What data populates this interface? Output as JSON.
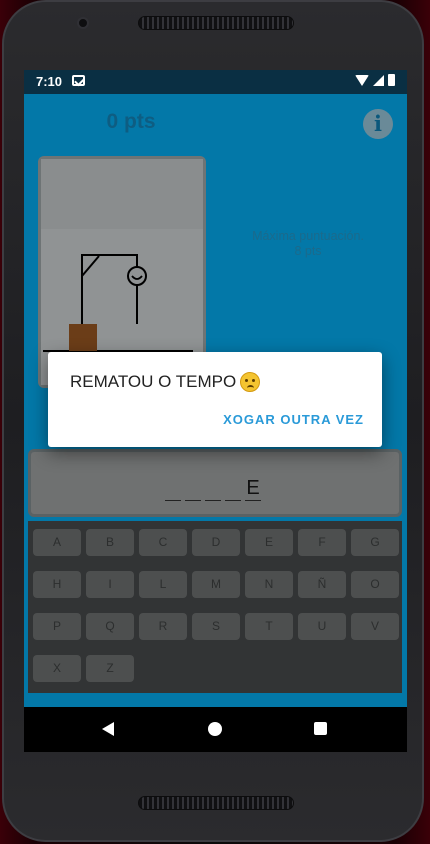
{
  "status_bar": {
    "time": "7:10",
    "notification_icon": "message-icon",
    "icons": [
      "wifi-icon",
      "signal-icon",
      "battery-icon"
    ]
  },
  "app": {
    "score_text": "0 pts",
    "info_icon": "i",
    "max_score": {
      "label": "Máxima puntuación.",
      "value": "8 pts"
    },
    "word_slots": [
      "",
      "",
      "",
      "",
      "E"
    ],
    "keyboard": {
      "rows": [
        [
          "A",
          "B",
          "C",
          "D",
          "E",
          "F",
          "G"
        ],
        [
          "H",
          "I",
          "L",
          "M",
          "N",
          "Ñ",
          "O"
        ],
        [
          "P",
          "Q",
          "R",
          "S",
          "T",
          "U",
          "V"
        ],
        [
          "X",
          "Z"
        ]
      ]
    }
  },
  "dialog": {
    "title": "REMATOU O TEMPO",
    "emoji": "sad-face-emoji",
    "button_label": "XOGAR OUTRA VEZ"
  },
  "navbar": {
    "buttons": [
      "back-icon",
      "home-icon",
      "recents-icon"
    ]
  },
  "colors": {
    "app_background": "#0378a8",
    "dialog_button": "#2a9ad8",
    "keyboard_background": "#323435"
  }
}
